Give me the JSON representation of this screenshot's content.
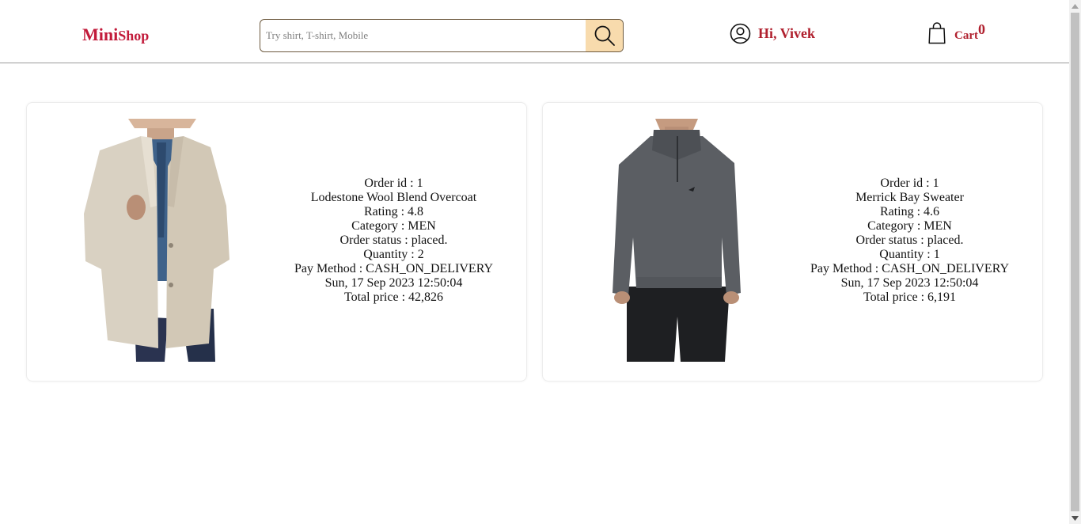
{
  "header": {
    "logo_part1": "Mini",
    "logo_part2": "Shop",
    "search_placeholder": "Try shirt, T-shirt, Mobile",
    "search_icon": "search-icon",
    "user_icon": "user-circle-icon",
    "user_greeting": "Hi, Vivek",
    "cart_icon": "shopping-bag-icon",
    "cart_label": "Cart",
    "cart_count": "0"
  },
  "colors": {
    "brand": "#c21a3a",
    "accent_text": "#b0202e",
    "search_button_bg": "#f8dbad"
  },
  "orders": [
    {
      "image": "coat-product-photo",
      "order_id": "Order id : 1",
      "name": "Lodestone Wool Blend Overcoat",
      "rating": "Rating : 4.8",
      "category": "Category : MEN",
      "status": "Order status : placed.",
      "quantity": "Quantity : 2",
      "pay_method": "Pay Method : CASH_ON_DELIVERY",
      "date": "Sun, 17 Sep 2023 12:50:04",
      "total": "Total price : 42,826"
    },
    {
      "image": "sweater-product-photo",
      "order_id": "Order id : 1",
      "name": "Merrick Bay Sweater",
      "rating": "Rating : 4.6",
      "category": "Category : MEN",
      "status": "Order status : placed.",
      "quantity": "Quantity : 1",
      "pay_method": "Pay Method : CASH_ON_DELIVERY",
      "date": "Sun, 17 Sep 2023 12:50:04",
      "total": "Total price : 6,191"
    }
  ]
}
